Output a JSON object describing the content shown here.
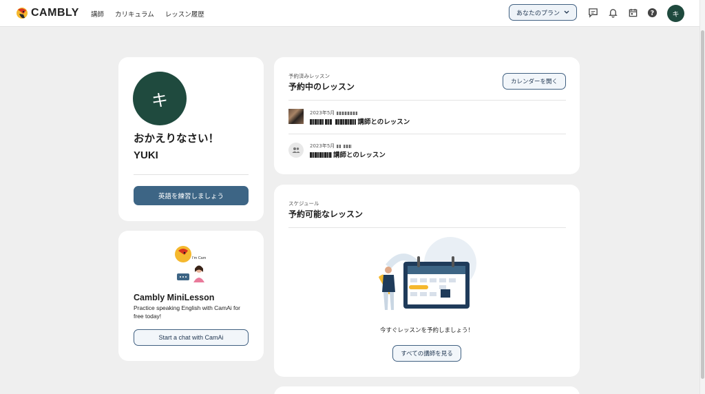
{
  "header": {
    "logo_text": "CAMBLY",
    "nav": [
      "講師",
      "カリキュラム",
      "レッスン履歴"
    ],
    "plan_button": "あなたのプラン",
    "avatar_initial": "キ",
    "icons": [
      "chat-icon",
      "bell-icon",
      "calendar-icon",
      "help-icon"
    ]
  },
  "welcome": {
    "avatar_initial": "キ",
    "greeting": "おかえりなさい！",
    "username": "YUKI",
    "cta": "英語を練習しましょう"
  },
  "mini_lesson": {
    "badge": "I'm Cam",
    "title": "Cambly MiniLesson",
    "description": "Practice speaking English with CamAi for free today!",
    "cta": "Start a chat with CamAi"
  },
  "booked": {
    "sub_label": "予約済みレッスン",
    "title": "予約中のレッスン",
    "calendar_button": "カレンダーを開く",
    "lessons": [
      {
        "date": "2023年5月",
        "name_suffix": "講師とのレッスン"
      },
      {
        "date": "2023年5月",
        "name_suffix": "講師とのレッスン"
      }
    ]
  },
  "schedule": {
    "sub_label": "スケジュール",
    "title": "予約可能なレッスン",
    "message": "今すぐレッスンを予約しましょう！",
    "button": "すべての講師を見る"
  },
  "colors": {
    "brand_dark": "#1f4a3e",
    "primary_button": "#3d6585",
    "outline": "#3f5f80",
    "background": "#efefef",
    "accent_yellow": "#f5b82e"
  }
}
